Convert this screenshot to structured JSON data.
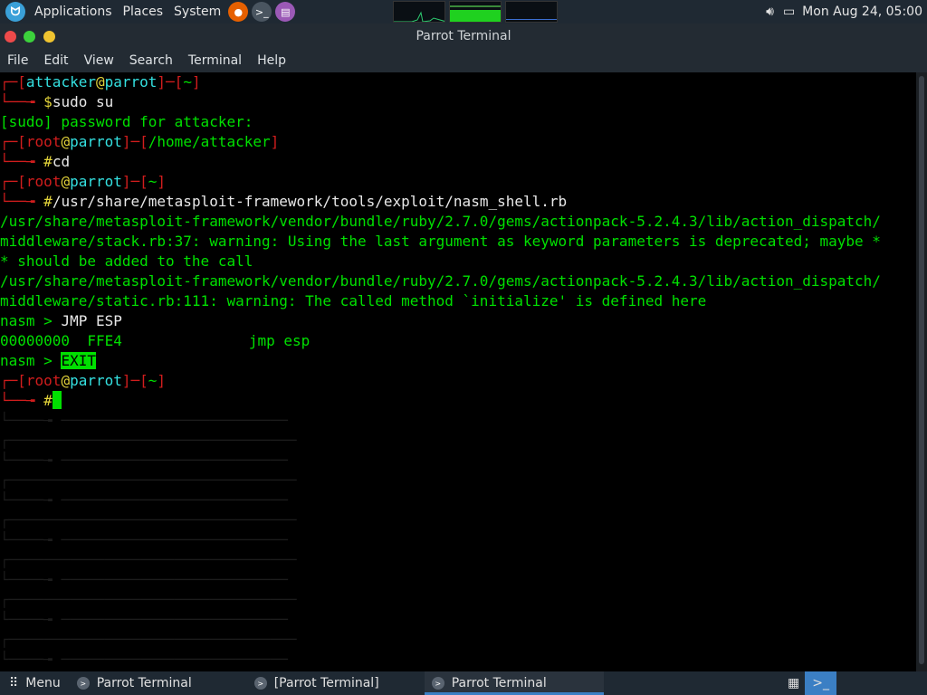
{
  "top_panel": {
    "applications": "Applications",
    "places": "Places",
    "system": "System",
    "clock": "Mon Aug 24, 05:00"
  },
  "window": {
    "title": "Parrot Terminal"
  },
  "menu": [
    "File",
    "Edit",
    "View",
    "Search",
    "Terminal",
    "Help"
  ],
  "terminal": {
    "user1": "attacker",
    "host": "parrot",
    "home": "~",
    "cmd_sudo": "sudo su",
    "sudo_prompt": "[sudo] password for attacker:",
    "root": "root",
    "path_home_attacker": "/home/attacker",
    "cmd_cd": "cd",
    "cmd_nasm": "/usr/share/metasploit-framework/tools/exploit/nasm_shell.rb",
    "warn1a": "/usr/share/metasploit-framework/vendor/bundle/ruby/2.7.0/gems/actionpack-5.2.4.3/lib/action_dispatch/",
    "warn1b": "middleware/stack.rb:37: warning: Using the last argument as keyword parameters is deprecated; maybe *",
    "warn1c": "* should be added to the call",
    "warn2a": "/usr/share/metasploit-framework/vendor/bundle/ruby/2.7.0/gems/actionpack-5.2.4.3/lib/action_dispatch/",
    "warn2b": "middleware/static.rb:111: warning: The called method `initialize' is defined here",
    "nasm_prompt": "nasm > ",
    "nasm_in1": "JMP ESP",
    "nasm_out_addr": "00000000  FFE4",
    "nasm_out_asm": "jmp esp",
    "nasm_in2": "EXIT"
  },
  "taskbar": {
    "menu": "Menu",
    "tasks": [
      "Parrot Terminal",
      "[Parrot Terminal]",
      "Parrot Terminal"
    ]
  }
}
